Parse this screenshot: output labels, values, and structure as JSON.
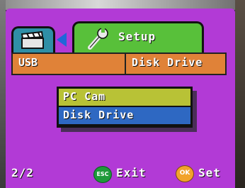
{
  "tabs": {
    "camera_icon": "clapperboard-icon",
    "setup_icon": "wrench-icon",
    "setup_label": "Setup"
  },
  "setting": {
    "name": "USB",
    "value": "Disk Drive"
  },
  "dropdown": {
    "options": [
      "PC Cam",
      "Disk Drive"
    ],
    "selected": "Disk Drive"
  },
  "footer": {
    "page": "2/2",
    "esc_button": "ESC",
    "exit_label": "Exit",
    "ok_button": "OK",
    "set_label": "Set"
  },
  "colors": {
    "background": "#b23ad6",
    "setup_tab": "#58c03a",
    "camera_tab": "#2f8fa6",
    "row_highlight": "#e08238",
    "option_pc_cam": "#b8c236",
    "option_selected": "#2e68c2"
  }
}
